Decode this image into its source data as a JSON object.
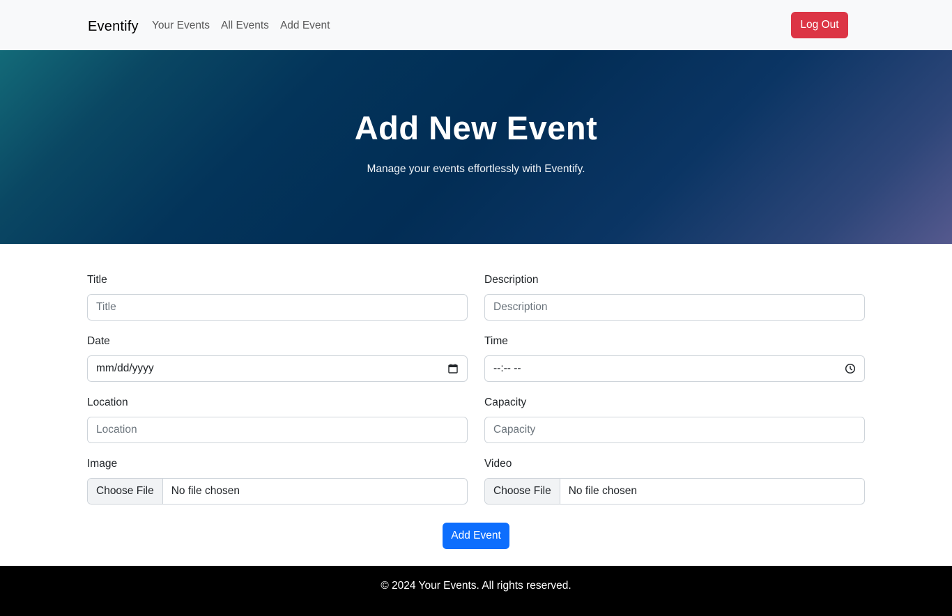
{
  "navbar": {
    "brand": "Eventify",
    "links": [
      "Your Events",
      "All Events",
      "Add Event"
    ],
    "logout_label": "Log Out"
  },
  "hero": {
    "title": "Add New Event",
    "subtitle": "Manage your events effortlessly with Eventify."
  },
  "form": {
    "title": {
      "label": "Title",
      "placeholder": "Title"
    },
    "description": {
      "label": "Description",
      "placeholder": "Description"
    },
    "date": {
      "label": "Date",
      "value": "mm/dd/yyyy"
    },
    "time": {
      "label": "Time",
      "value": "--:-- --"
    },
    "location": {
      "label": "Location",
      "placeholder": "Location"
    },
    "capacity": {
      "label": "Capacity",
      "placeholder": "Capacity"
    },
    "image": {
      "label": "Image",
      "button": "Choose File",
      "status": "No file chosen"
    },
    "video": {
      "label": "Video",
      "button": "Choose File",
      "status": "No file chosen"
    },
    "submit_label": "Add Event"
  },
  "footer": {
    "text": "© 2024 Your Events. All rights reserved."
  },
  "colors": {
    "logout": "#dc3545",
    "submit": "#0d6efd",
    "navbar_bg": "#f8f9fa",
    "footer_bg": "#000000"
  },
  "icons": {
    "date": "calendar-icon",
    "time": "clock-icon"
  }
}
